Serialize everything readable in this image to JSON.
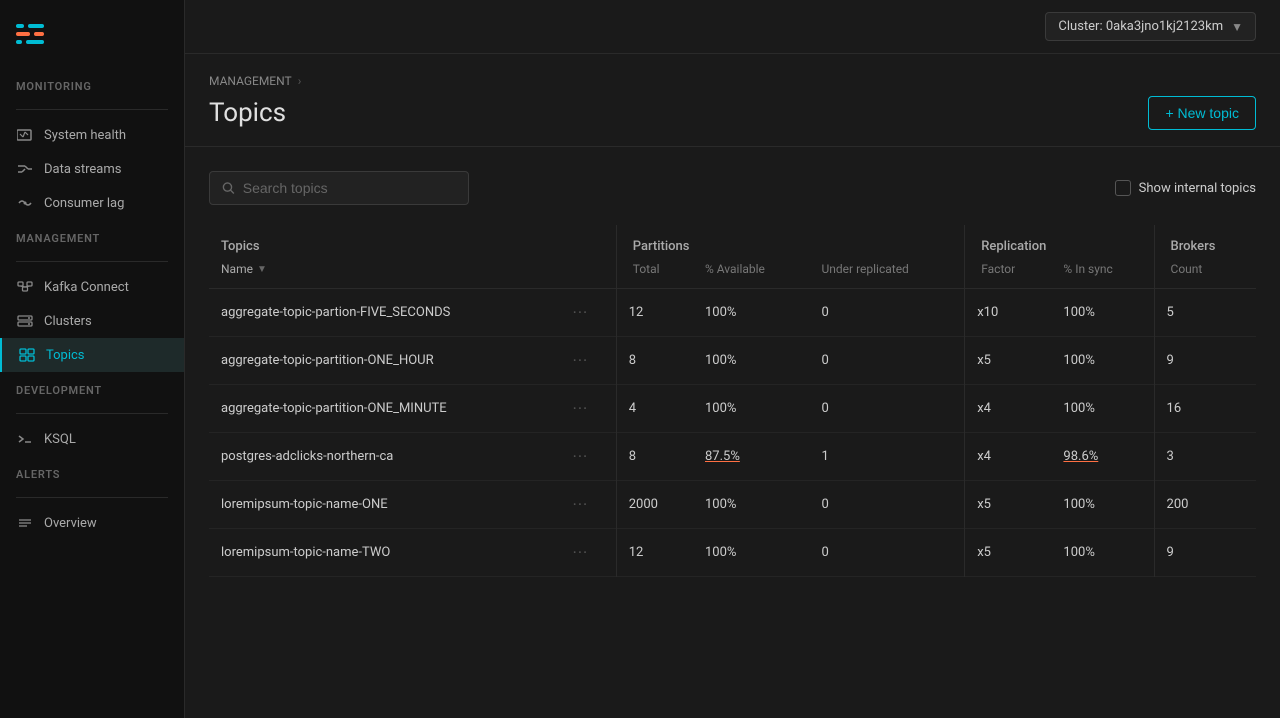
{
  "sidebar": {
    "monitoring_label": "MONITORING",
    "management_label": "MANAGEMENT",
    "development_label": "DEVELOPMENT",
    "alerts_label": "ALERTS",
    "items": {
      "system_health": "System health",
      "data_streams": "Data streams",
      "consumer_lag": "Consumer lag",
      "kafka_connect": "Kafka Connect",
      "clusters": "Clusters",
      "topics": "Topics",
      "ksql": "KSQL",
      "overview": "Overview"
    }
  },
  "topbar": {
    "cluster_label": "Cluster: 0aka3jno1kj2123km"
  },
  "header": {
    "breadcrumb_management": "MANAGEMENT",
    "page_title": "Topics",
    "new_topic_btn": "+ New topic"
  },
  "toolbar": {
    "search_placeholder": "Search topics",
    "show_internal_label": "Show internal topics"
  },
  "table": {
    "col_topics": "Topics",
    "col_name": "Name",
    "col_partitions": "Partitions",
    "col_total": "Total",
    "col_pct_available": "% Available",
    "col_under_replicated": "Under replicated",
    "col_replication": "Replication",
    "col_factor": "Factor",
    "col_pct_in_sync": "% In sync",
    "col_brokers": "Brokers",
    "col_count": "Count",
    "rows": [
      {
        "name": "aggregate-topic-partion-FIVE_SECONDS",
        "total": "12",
        "pct_available": "100%",
        "under_replicated": "0",
        "factor": "x10",
        "pct_in_sync": "100%",
        "count": "5",
        "warning_available": false,
        "warning_under": false
      },
      {
        "name": "aggregate-topic-partition-ONE_HOUR",
        "total": "8",
        "pct_available": "100%",
        "under_replicated": "0",
        "factor": "x5",
        "pct_in_sync": "100%",
        "count": "9",
        "warning_available": false,
        "warning_under": false
      },
      {
        "name": "aggregate-topic-partition-ONE_MINUTE",
        "total": "4",
        "pct_available": "100%",
        "under_replicated": "0",
        "factor": "x4",
        "pct_in_sync": "100%",
        "count": "16",
        "warning_available": false,
        "warning_under": false
      },
      {
        "name": "postgres-adclicks-northern-ca",
        "total": "8",
        "pct_available": "87.5%",
        "under_replicated": "1",
        "factor": "x4",
        "pct_in_sync": "98.6%",
        "count": "3",
        "warning_available": true,
        "warning_under": true
      },
      {
        "name": "loremipsum-topic-name-ONE",
        "total": "2000",
        "pct_available": "100%",
        "under_replicated": "0",
        "factor": "x5",
        "pct_in_sync": "100%",
        "count": "200",
        "warning_available": false,
        "warning_under": false
      },
      {
        "name": "loremipsum-topic-name-TWO",
        "total": "12",
        "pct_available": "100%",
        "under_replicated": "0",
        "factor": "x5",
        "pct_in_sync": "100%",
        "count": "9",
        "warning_available": false,
        "warning_under": false
      }
    ]
  }
}
